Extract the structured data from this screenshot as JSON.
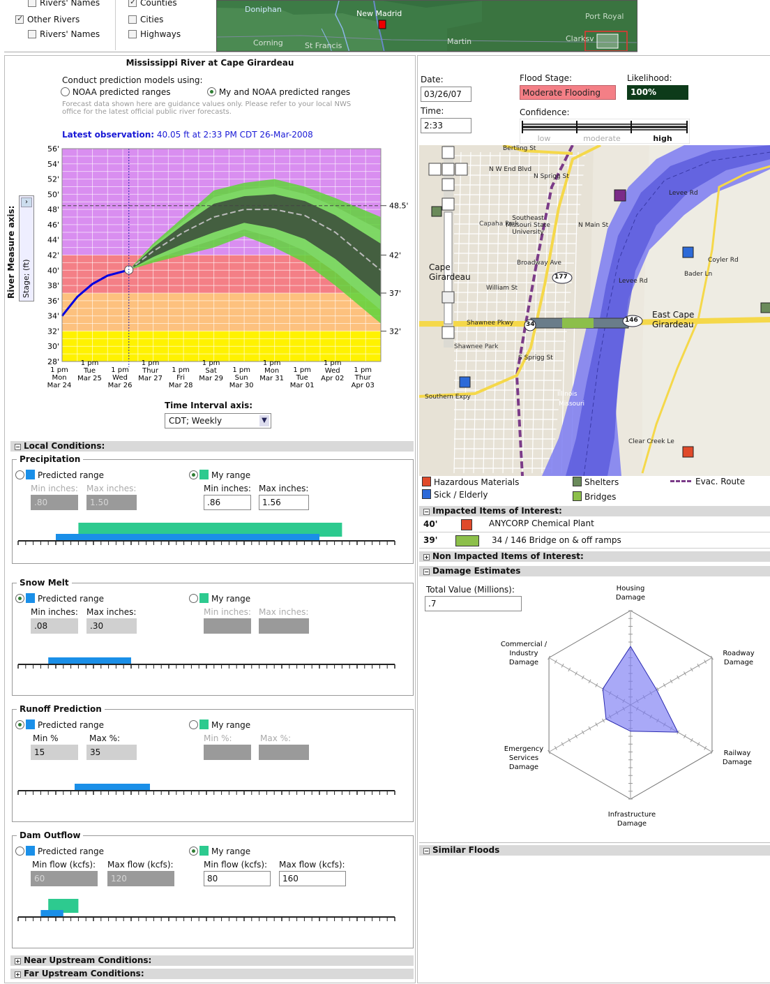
{
  "top": {
    "items": [
      {
        "label": "Rivers' Names",
        "checked": false
      },
      {
        "label": "Counties",
        "checked": true
      },
      {
        "label": "Other Rivers",
        "checked": true
      },
      {
        "label": "Cities",
        "checked": false
      },
      {
        "label": "Rivers' Names",
        "checked": false
      },
      {
        "label": "Highways",
        "checked": false
      }
    ],
    "map_labels": [
      "Doniphan",
      "New Madrid",
      "Port Royal",
      "Corning",
      "St Francis",
      "Martin",
      "Clarksv"
    ]
  },
  "chart_title": "Mississippi River at Cape Girardeau",
  "prediction": {
    "prompt": "Conduct prediction models using:",
    "option1": "NOAA predicted ranges",
    "option2": "My and NOAA predicted ranges",
    "selected": 2,
    "disclaimer1": "Forecast data shown here are guidance values only.  Please refer to your local NWS",
    "disclaimer2": "office for the latest official public river forecasts."
  },
  "observation": {
    "label": "Latest observation:",
    "value": "40.05 ft at 2:33 PM CDT 26-Mar-2008"
  },
  "chart_data": {
    "type": "line",
    "yaxis_title": "River Measure axis:",
    "yaxis_select": "Stage; (ft)",
    "ylim": [
      28,
      56
    ],
    "yticks": [
      "56'",
      "54'",
      "52'",
      "50'",
      "48'",
      "46'",
      "44'",
      "42'",
      "40'",
      "38'",
      "36'",
      "34'",
      "32'",
      "30'",
      "28'"
    ],
    "bands": [
      {
        "from": 42,
        "to": 56,
        "color": "#d98ef0"
      },
      {
        "from": 37,
        "to": 42,
        "color": "#f47f86"
      },
      {
        "from": 32,
        "to": 37,
        "color": "#fdc17e"
      },
      {
        "from": 28,
        "to": 32,
        "color": "#fff200"
      }
    ],
    "right_marks": [
      "48.5'",
      "42'",
      "37'",
      "32'"
    ],
    "right_values": [
      48.5,
      42,
      37,
      32
    ],
    "x_labels": [
      [
        "1 pm",
        "Mon",
        "Mar 24"
      ],
      [
        "1 pm",
        "Tue",
        "Mar 25"
      ],
      [
        "1 pm",
        "Wed",
        "Mar 26"
      ],
      [
        "1 pm",
        "Thur",
        "Mar 27"
      ],
      [
        "1 pm",
        "Fri",
        "Mar 28"
      ],
      [
        "1 pm",
        "Sat",
        "Mar 29"
      ],
      [
        "1 pm",
        "Sun",
        "Mar 30"
      ],
      [
        "1 pm",
        "Mon",
        "Mar 31"
      ],
      [
        "1 pm",
        "Tue",
        "Mar 01"
      ],
      [
        "1 pm",
        "Wed",
        "Apr 02"
      ],
      [
        "1 pm",
        "Thur",
        "Apr 03"
      ]
    ],
    "observed": {
      "x": [
        0,
        0.5,
        1,
        1.5,
        2.2
      ],
      "y": [
        34,
        36.5,
        38.2,
        39.3,
        40.05
      ]
    },
    "forecast_mid": {
      "x": [
        2.2,
        3,
        4,
        5,
        6,
        7,
        8,
        9,
        10.5
      ],
      "y": [
        40.05,
        42.5,
        45,
        47,
        48,
        48,
        47.2,
        45,
        40
      ]
    },
    "forecast_outer_hi": {
      "x": [
        2.2,
        3,
        4,
        5,
        6,
        7,
        8,
        9,
        10.5
      ],
      "y": [
        40.05,
        43.5,
        47,
        50.5,
        51.5,
        52,
        51,
        49.5,
        47
      ]
    },
    "forecast_outer_lo": {
      "x": [
        2.2,
        3,
        4,
        5,
        6,
        7,
        8,
        9,
        10.5
      ],
      "y": [
        40.05,
        41,
        42,
        43,
        44.5,
        43,
        41,
        38,
        33
      ]
    }
  },
  "interval": {
    "label": "Time Interval axis:",
    "value": "CDT; Weekly"
  },
  "local": {
    "title": "Local Conditions:",
    "precip": {
      "title": "Precipitation",
      "pred": "Predicted range",
      "my": "My range",
      "pred_selected": false,
      "min_label": "Min inches:",
      "max_label": "Max inches:",
      "pred_min": ".80",
      "pred_max": "1.50",
      "my_min": ".86",
      "my_max": "1.56",
      "ticks": [
        ".70",
        ".80",
        ".90",
        "1",
        "1.10",
        "1.20",
        "1.30",
        "1.40",
        "1.50",
        "1.60",
        "1.70"
      ],
      "pred_range": [
        0.8,
        1.5
      ],
      "my_range": [
        0.86,
        1.56
      ],
      "axis": [
        0.7,
        1.7
      ]
    },
    "snow": {
      "title": "Snow Melt",
      "pred": "Predicted range",
      "my": "My range",
      "pred_selected": true,
      "min_label": "Min inches:",
      "max_label": "Max inches:",
      "pred_min": ".08",
      "pred_max": ".30",
      "ticks": [
        "0",
        ".10",
        ".20",
        ".30",
        ".40",
        ".50",
        ".60",
        ".70",
        ".80",
        ".90",
        "1.0"
      ],
      "pred_range": [
        0.08,
        0.3
      ],
      "axis": [
        0,
        1
      ]
    },
    "runoff": {
      "title": "Runoff Prediction",
      "pred": "Predicted range",
      "my": "My range",
      "pred_selected": true,
      "min_label": "Min %",
      "max_label": "Max %:",
      "my_min_label": "Min %:",
      "my_max_label": "Max %:",
      "pred_min": "15",
      "pred_max": "35",
      "ticks": [
        "0",
        "10%",
        "20%",
        "30%",
        "40%",
        "50%",
        "60%",
        "70%",
        "80%",
        "90%",
        "100%"
      ],
      "pred_range": [
        15,
        35
      ],
      "axis": [
        0,
        100
      ]
    },
    "dam": {
      "title": "Dam Outflow",
      "pred": "Predicted range",
      "my": "My range",
      "pred_selected": false,
      "min_label": "Min flow (kcfs):",
      "max_label": "Max flow (kcfs):",
      "pred_min": "60",
      "pred_max": "120",
      "my_min": "80",
      "my_max": "160",
      "ticks": [
        "0",
        "100",
        "200",
        "300",
        "400",
        "500",
        "600",
        "700",
        "800",
        "900",
        "1000"
      ],
      "pred_range": [
        60,
        120
      ],
      "my_range": [
        80,
        160
      ],
      "axis": [
        0,
        1000
      ]
    }
  },
  "near_upstream": "Near Upstream Conditions:",
  "far_upstream": "Far Upstream Conditions:",
  "right": {
    "date_label": "Date:",
    "date": "03/26/07",
    "time_label": "Time:",
    "time": "2:33",
    "flood_label": "Flood Stage:",
    "flood_value": "Moderate Flooding",
    "likelihood_label": "Likelihood:",
    "likelihood_value": "100%",
    "confidence_label": "Confidence:",
    "confidence_levels": [
      "low",
      "moderate",
      "high"
    ],
    "map_labels": [
      "Bertling St",
      "Southeast Missouri State University",
      "Capaha Park",
      "Cape Girardeau",
      "Broadway Ave",
      "William St",
      "Shawnee Pkwy",
      "Shawnee Park",
      "Southern Expy",
      "N Main St",
      "S Sprigg St",
      "N Sprigg St",
      "N W End Blvd",
      "Levee Rd",
      "Coyler Rd",
      "Bader Ln",
      "East Cape Girardeau",
      "Illinois",
      "Missouri",
      "Clear Creek Le",
      "Levee Rd",
      "177",
      "146",
      "34"
    ],
    "legend": [
      "Hazardous Materials",
      "Shelters",
      "Evac. Route",
      "Sick / Elderly",
      "Bridges"
    ],
    "impacted_title": "Impacted Items of Interest:",
    "impacted": [
      {
        "stage": "40'",
        "name": "ANYCORP Chemical Plant"
      },
      {
        "stage": "39'",
        "name": "34 / 146 Bridge on & off ramps"
      }
    ],
    "non_impacted_title": "Non Impacted Items of Interest:",
    "damage_title": "Damage Estimates",
    "total_label": "Total Value (Millions):",
    "total_value": ".7",
    "radar_axes": [
      "Housing Damage",
      "Roadway Damage",
      "Railway Damage",
      "Infrastructure Damage",
      "Emergency Services Damage",
      "Commercial / Industry Damage"
    ],
    "radar_values": [
      0.62,
      0.32,
      0.58,
      0.28,
      0.3,
      0.34
    ],
    "similar_title": "Similar Floods",
    "colors": {
      "flood": "#f47f86",
      "likelihood": "#0d3b1a",
      "river": "#7b7bf2",
      "road": "#f5d84a"
    }
  }
}
